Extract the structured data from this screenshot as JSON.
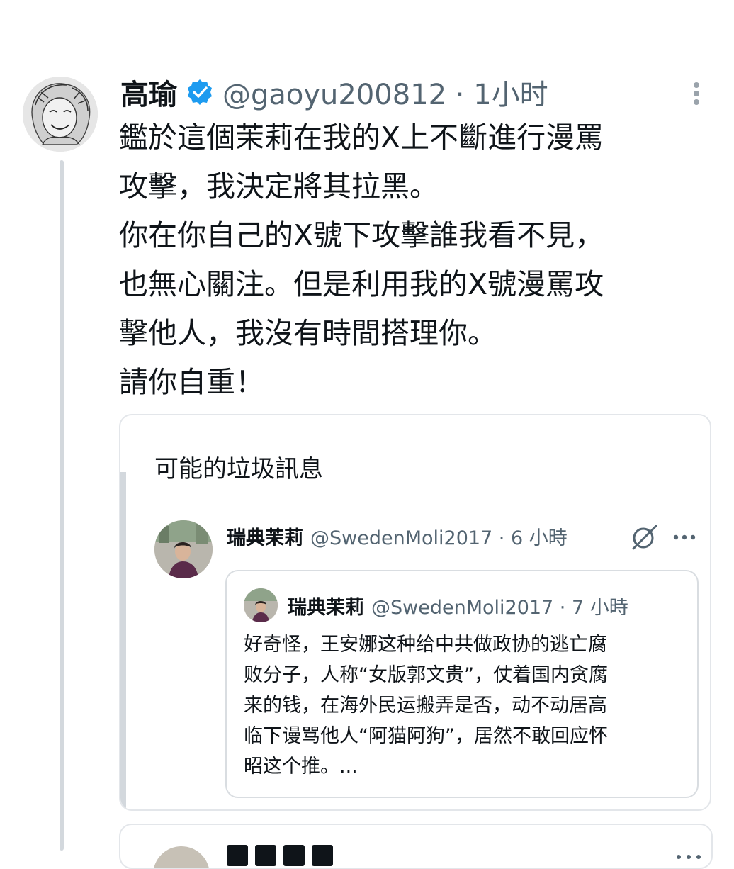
{
  "tweet": {
    "author_name": "高瑜",
    "handle_time": "@gaoyu200812 · 1小时",
    "lines": [
      "鑑於這個茉莉在我的X上不斷進行漫罵",
      "攻擊，我決定將其拉黑。",
      "你在你自己的X號下攻擊誰我看不見，",
      "也無心關注。但是利用我的X號漫罵攻",
      "擊他人，我沒有時間搭理你。",
      "請你自重！"
    ]
  },
  "quote": {
    "spam_label": "可能的垃圾訊息",
    "author_name": "瑞典茉莉",
    "handle_time": "@SwedenMoli2017 · 6 小時"
  },
  "nested_quote": {
    "author_name": "瑞典茉莉",
    "handle_time": "@SwedenMoli2017 · 7 小時",
    "lines": [
      "好奇怪，王安娜这种给中共做政协的逃亡腐",
      "败分子，人称“女版郭文贵”，仗着国内贪腐",
      "来的钱，在海外民运搬弄是否，动不动居高",
      "临下谩骂他人“阿猫阿狗”，居然不敢回应怀",
      "昭这个推。..."
    ]
  },
  "colors": {
    "text_primary": "#0f1419",
    "text_secondary": "#536471",
    "verified_blue": "#1d9bf0",
    "border": "#e3e6ea",
    "thread_line": "#d3d8dd"
  }
}
